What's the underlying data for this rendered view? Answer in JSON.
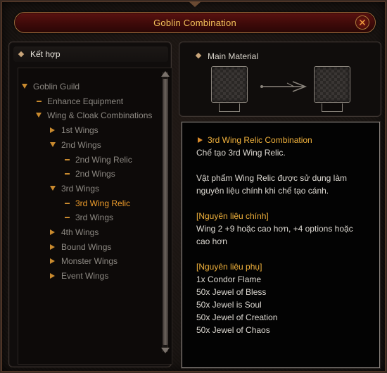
{
  "window": {
    "title": "Goblin Combination"
  },
  "left": {
    "header": "Kết hợp",
    "tree": [
      {
        "label": "Goblin Guild",
        "icon": "arrow-down"
      },
      {
        "label": "Enhance Equipment",
        "icon": "dash"
      },
      {
        "label": "Wing & Cloak Combinations",
        "icon": "arrow-down"
      },
      {
        "label": "1st Wings",
        "icon": "arrow-right"
      },
      {
        "label": "2nd Wings",
        "icon": "arrow-down"
      },
      {
        "label": "2nd Wing Relic",
        "icon": "dash"
      },
      {
        "label": "2nd Wings",
        "icon": "dash"
      },
      {
        "label": "3rd Wings",
        "icon": "arrow-down"
      },
      {
        "label": "3rd Wing Relic",
        "icon": "dash",
        "selected": true
      },
      {
        "label": "3rd Wings",
        "icon": "dash"
      },
      {
        "label": "4th Wings",
        "icon": "arrow-right"
      },
      {
        "label": "Bound Wings",
        "icon": "arrow-right"
      },
      {
        "label": "Monster Wings",
        "icon": "arrow-right"
      },
      {
        "label": "Event Wings",
        "icon": "arrow-right"
      }
    ]
  },
  "main_material": {
    "label": "Main Material"
  },
  "detail": {
    "title": "3rd Wing Relic Combination",
    "lines": [
      "Chế tạo 3rd Wing Relic.",
      "",
      "Vật phẩm Wing Relic được sử dụng làm",
      "nguyên liệu chính khi chế tạo cánh.",
      "",
      "[Nguyên liệu chính]",
      "Wing 2 +9 hoặc cao hơn, +4 options hoặc",
      "cao hơn",
      "",
      "[Nguyên liệu phụ]",
      "1x Condor Flame",
      "50x Jewel of Bless",
      "50x Jewel is Soul",
      "50x Jewel of Creation",
      "50x Jewel of Chaos"
    ]
  },
  "colors": {
    "accent_gold": "#f0b13c",
    "selected_orange": "#ef9d2b",
    "title_gold": "#f2c15a",
    "title_bar_red": "#4a0d0b"
  }
}
